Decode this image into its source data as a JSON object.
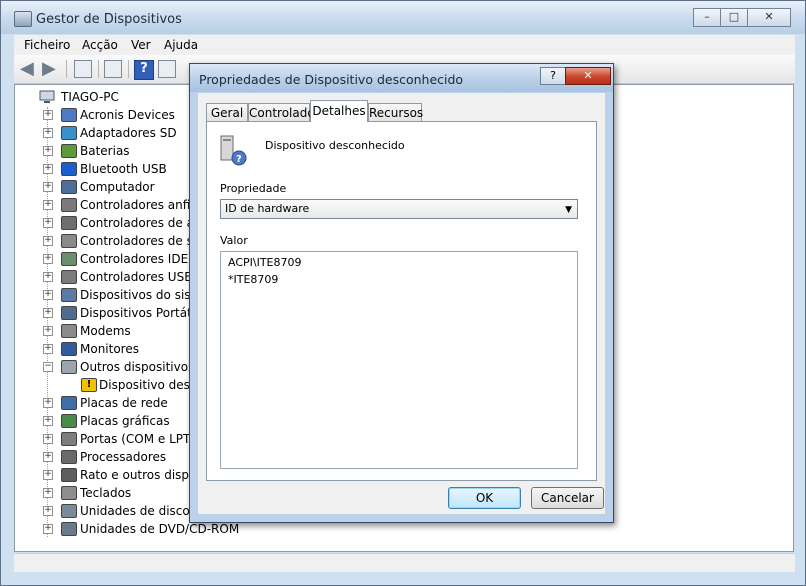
{
  "window": {
    "title": "Gestor de Dispositivos",
    "minimize": "–",
    "maximize": "□",
    "close": "✕"
  },
  "menu": [
    "Ficheiro",
    "Acção",
    "Ver",
    "Ajuda"
  ],
  "toolbar": {
    "back_icon": "back-arrow-icon",
    "forward_icon": "forward-arrow-icon",
    "help_glyph": "?"
  },
  "tree": {
    "root": "TIAGO-PC",
    "items": [
      {
        "label": "Acronis Devices",
        "icon": "device-icon",
        "expander": "+"
      },
      {
        "label": "Adaptadores SD",
        "icon": "sd-adapter-icon",
        "expander": "+"
      },
      {
        "label": "Baterias",
        "icon": "battery-icon",
        "expander": "+"
      },
      {
        "label": "Bluetooth USB",
        "icon": "bluetooth-icon",
        "expander": "+"
      },
      {
        "label": "Computador",
        "icon": "computer-icon",
        "expander": "+"
      },
      {
        "label": "Controladores anfitri",
        "icon": "host-controller-icon",
        "expander": "+"
      },
      {
        "label": "Controladores de arm",
        "icon": "storage-controller-icon",
        "expander": "+"
      },
      {
        "label": "Controladores de som",
        "icon": "sound-icon",
        "expander": "+"
      },
      {
        "label": "Controladores IDE AT",
        "icon": "ide-icon",
        "expander": "+"
      },
      {
        "label": "Controladores USB (U",
        "icon": "usb-icon",
        "expander": "+"
      },
      {
        "label": "Dispositivos do sistem",
        "icon": "system-device-icon",
        "expander": "+"
      },
      {
        "label": "Dispositivos Portáteis",
        "icon": "portable-device-icon",
        "expander": "+"
      },
      {
        "label": "Modems",
        "icon": "modem-icon",
        "expander": "+"
      },
      {
        "label": "Monitores",
        "icon": "monitor-icon",
        "expander": "+"
      },
      {
        "label": "Outros dispositivos",
        "icon": "other-devices-icon",
        "expander": "−"
      },
      {
        "label": "Dispositivo desco",
        "icon": "unknown-device-warning-icon",
        "expander": "",
        "child": true
      },
      {
        "label": "Placas de rede",
        "icon": "network-card-icon",
        "expander": "+"
      },
      {
        "label": "Placas gráficas",
        "icon": "graphics-card-icon",
        "expander": "+"
      },
      {
        "label": "Portas (COM e LPT)",
        "icon": "ports-icon",
        "expander": "+"
      },
      {
        "label": "Processadores",
        "icon": "processor-icon",
        "expander": "+"
      },
      {
        "label": "Rato e outros disposit",
        "icon": "mouse-icon",
        "expander": "+"
      },
      {
        "label": "Teclados",
        "icon": "keyboard-icon",
        "expander": "+"
      },
      {
        "label": "Unidades de disco",
        "icon": "disk-drive-icon",
        "expander": "+"
      },
      {
        "label": "Unidades de DVD/CD-ROM",
        "icon": "dvd-drive-icon",
        "expander": "+"
      }
    ]
  },
  "dialog": {
    "title": "Propriedades de Dispositivo desconhecido",
    "help": "?",
    "close": "✕",
    "tabs": [
      "Geral",
      "Controlador",
      "Detalhes",
      "Recursos"
    ],
    "active_tab": "Detalhes",
    "device_name": "Dispositivo desconhecido",
    "property_label": "Propriedade",
    "property_value": "ID de hardware",
    "value_label": "Valor",
    "values": [
      "ACPI\\ITE8709",
      "*ITE8709"
    ],
    "ok": "OK",
    "cancel": "Cancelar"
  },
  "colors": {
    "accent": "#3c7fb1",
    "warning": "#f2c200",
    "close_button": "#c8442a"
  }
}
